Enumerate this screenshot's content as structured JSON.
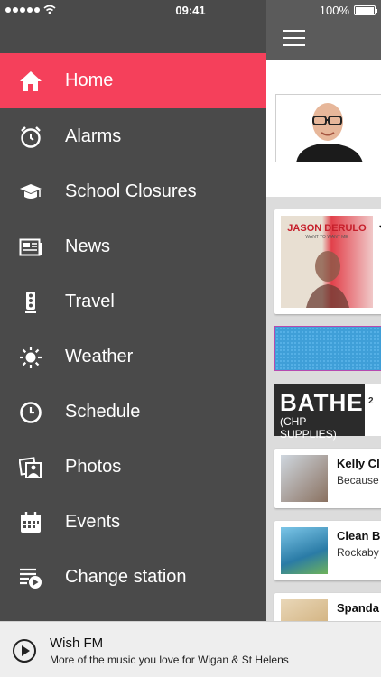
{
  "status_bar": {
    "time": "09:41",
    "battery": "100%",
    "signal_icon": "signal-dots-icon",
    "wifi_icon": "wifi-icon"
  },
  "menu": {
    "accent_color": "#f5405b",
    "background_color": "#4a4a4a",
    "items": [
      {
        "label": "Home",
        "icon": "home-icon",
        "active": true
      },
      {
        "label": "Alarms",
        "icon": "alarm-clock-icon",
        "active": false
      },
      {
        "label": "School Closures",
        "icon": "graduation-cap-icon",
        "active": false
      },
      {
        "label": "News",
        "icon": "newspaper-icon",
        "active": false
      },
      {
        "label": "Travel",
        "icon": "traffic-light-icon",
        "active": false
      },
      {
        "label": "Weather",
        "icon": "sun-icon",
        "active": false
      },
      {
        "label": "Schedule",
        "icon": "clock-icon",
        "active": false
      },
      {
        "label": "Photos",
        "icon": "photos-icon",
        "active": false
      },
      {
        "label": "Events",
        "icon": "calendar-icon",
        "active": false
      },
      {
        "label": "Change station",
        "icon": "playlist-play-icon",
        "active": false
      }
    ]
  },
  "content": {
    "album_banner_text": "JASON DERULO",
    "album_banner_sub": "WANT TO WANT ME",
    "partial_letter": "J",
    "ad_text": "BATHE",
    "ad_sub": "(CHP SUPPLIES)",
    "ad_side": "2",
    "songs": [
      {
        "title": "Kelly Cl",
        "artist": "Because"
      },
      {
        "title": "Clean B",
        "artist": "Rockaby"
      },
      {
        "title": "Spanda",
        "artist": ""
      }
    ]
  },
  "player": {
    "station": "Wish FM",
    "tagline": "More of the music you love for Wigan & St Helens"
  }
}
